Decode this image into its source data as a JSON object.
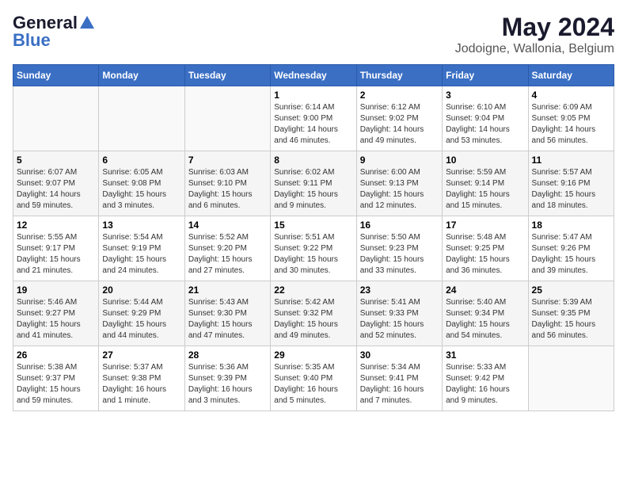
{
  "header": {
    "logo_general": "General",
    "logo_blue": "Blue",
    "month": "May 2024",
    "location": "Jodoigne, Wallonia, Belgium"
  },
  "days_of_week": [
    "Sunday",
    "Monday",
    "Tuesday",
    "Wednesday",
    "Thursday",
    "Friday",
    "Saturday"
  ],
  "weeks": [
    [
      {
        "day": "",
        "sunrise": "",
        "sunset": "",
        "daylight": ""
      },
      {
        "day": "",
        "sunrise": "",
        "sunset": "",
        "daylight": ""
      },
      {
        "day": "",
        "sunrise": "",
        "sunset": "",
        "daylight": ""
      },
      {
        "day": "1",
        "sunrise": "Sunrise: 6:14 AM",
        "sunset": "Sunset: 9:00 PM",
        "daylight": "Daylight: 14 hours and 46 minutes."
      },
      {
        "day": "2",
        "sunrise": "Sunrise: 6:12 AM",
        "sunset": "Sunset: 9:02 PM",
        "daylight": "Daylight: 14 hours and 49 minutes."
      },
      {
        "day": "3",
        "sunrise": "Sunrise: 6:10 AM",
        "sunset": "Sunset: 9:04 PM",
        "daylight": "Daylight: 14 hours and 53 minutes."
      },
      {
        "day": "4",
        "sunrise": "Sunrise: 6:09 AM",
        "sunset": "Sunset: 9:05 PM",
        "daylight": "Daylight: 14 hours and 56 minutes."
      }
    ],
    [
      {
        "day": "5",
        "sunrise": "Sunrise: 6:07 AM",
        "sunset": "Sunset: 9:07 PM",
        "daylight": "Daylight: 14 hours and 59 minutes."
      },
      {
        "day": "6",
        "sunrise": "Sunrise: 6:05 AM",
        "sunset": "Sunset: 9:08 PM",
        "daylight": "Daylight: 15 hours and 3 minutes."
      },
      {
        "day": "7",
        "sunrise": "Sunrise: 6:03 AM",
        "sunset": "Sunset: 9:10 PM",
        "daylight": "Daylight: 15 hours and 6 minutes."
      },
      {
        "day": "8",
        "sunrise": "Sunrise: 6:02 AM",
        "sunset": "Sunset: 9:11 PM",
        "daylight": "Daylight: 15 hours and 9 minutes."
      },
      {
        "day": "9",
        "sunrise": "Sunrise: 6:00 AM",
        "sunset": "Sunset: 9:13 PM",
        "daylight": "Daylight: 15 hours and 12 minutes."
      },
      {
        "day": "10",
        "sunrise": "Sunrise: 5:59 AM",
        "sunset": "Sunset: 9:14 PM",
        "daylight": "Daylight: 15 hours and 15 minutes."
      },
      {
        "day": "11",
        "sunrise": "Sunrise: 5:57 AM",
        "sunset": "Sunset: 9:16 PM",
        "daylight": "Daylight: 15 hours and 18 minutes."
      }
    ],
    [
      {
        "day": "12",
        "sunrise": "Sunrise: 5:55 AM",
        "sunset": "Sunset: 9:17 PM",
        "daylight": "Daylight: 15 hours and 21 minutes."
      },
      {
        "day": "13",
        "sunrise": "Sunrise: 5:54 AM",
        "sunset": "Sunset: 9:19 PM",
        "daylight": "Daylight: 15 hours and 24 minutes."
      },
      {
        "day": "14",
        "sunrise": "Sunrise: 5:52 AM",
        "sunset": "Sunset: 9:20 PM",
        "daylight": "Daylight: 15 hours and 27 minutes."
      },
      {
        "day": "15",
        "sunrise": "Sunrise: 5:51 AM",
        "sunset": "Sunset: 9:22 PM",
        "daylight": "Daylight: 15 hours and 30 minutes."
      },
      {
        "day": "16",
        "sunrise": "Sunrise: 5:50 AM",
        "sunset": "Sunset: 9:23 PM",
        "daylight": "Daylight: 15 hours and 33 minutes."
      },
      {
        "day": "17",
        "sunrise": "Sunrise: 5:48 AM",
        "sunset": "Sunset: 9:25 PM",
        "daylight": "Daylight: 15 hours and 36 minutes."
      },
      {
        "day": "18",
        "sunrise": "Sunrise: 5:47 AM",
        "sunset": "Sunset: 9:26 PM",
        "daylight": "Daylight: 15 hours and 39 minutes."
      }
    ],
    [
      {
        "day": "19",
        "sunrise": "Sunrise: 5:46 AM",
        "sunset": "Sunset: 9:27 PM",
        "daylight": "Daylight: 15 hours and 41 minutes."
      },
      {
        "day": "20",
        "sunrise": "Sunrise: 5:44 AM",
        "sunset": "Sunset: 9:29 PM",
        "daylight": "Daylight: 15 hours and 44 minutes."
      },
      {
        "day": "21",
        "sunrise": "Sunrise: 5:43 AM",
        "sunset": "Sunset: 9:30 PM",
        "daylight": "Daylight: 15 hours and 47 minutes."
      },
      {
        "day": "22",
        "sunrise": "Sunrise: 5:42 AM",
        "sunset": "Sunset: 9:32 PM",
        "daylight": "Daylight: 15 hours and 49 minutes."
      },
      {
        "day": "23",
        "sunrise": "Sunrise: 5:41 AM",
        "sunset": "Sunset: 9:33 PM",
        "daylight": "Daylight: 15 hours and 52 minutes."
      },
      {
        "day": "24",
        "sunrise": "Sunrise: 5:40 AM",
        "sunset": "Sunset: 9:34 PM",
        "daylight": "Daylight: 15 hours and 54 minutes."
      },
      {
        "day": "25",
        "sunrise": "Sunrise: 5:39 AM",
        "sunset": "Sunset: 9:35 PM",
        "daylight": "Daylight: 15 hours and 56 minutes."
      }
    ],
    [
      {
        "day": "26",
        "sunrise": "Sunrise: 5:38 AM",
        "sunset": "Sunset: 9:37 PM",
        "daylight": "Daylight: 15 hours and 59 minutes."
      },
      {
        "day": "27",
        "sunrise": "Sunrise: 5:37 AM",
        "sunset": "Sunset: 9:38 PM",
        "daylight": "Daylight: 16 hours and 1 minute."
      },
      {
        "day": "28",
        "sunrise": "Sunrise: 5:36 AM",
        "sunset": "Sunset: 9:39 PM",
        "daylight": "Daylight: 16 hours and 3 minutes."
      },
      {
        "day": "29",
        "sunrise": "Sunrise: 5:35 AM",
        "sunset": "Sunset: 9:40 PM",
        "daylight": "Daylight: 16 hours and 5 minutes."
      },
      {
        "day": "30",
        "sunrise": "Sunrise: 5:34 AM",
        "sunset": "Sunset: 9:41 PM",
        "daylight": "Daylight: 16 hours and 7 minutes."
      },
      {
        "day": "31",
        "sunrise": "Sunrise: 5:33 AM",
        "sunset": "Sunset: 9:42 PM",
        "daylight": "Daylight: 16 hours and 9 minutes."
      },
      {
        "day": "",
        "sunrise": "",
        "sunset": "",
        "daylight": ""
      }
    ]
  ]
}
